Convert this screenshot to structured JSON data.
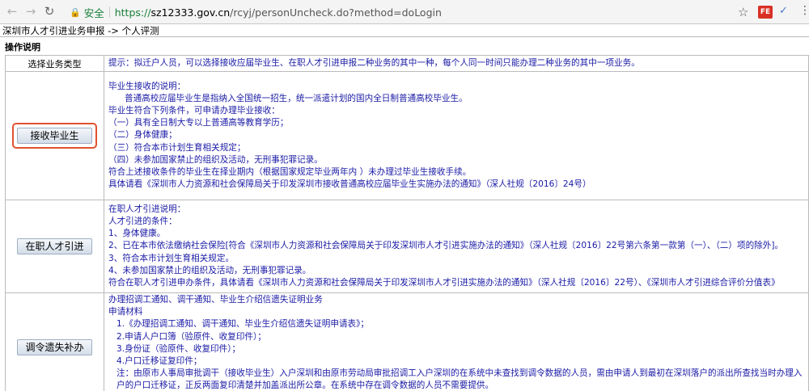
{
  "browser": {
    "secure_label": "安全",
    "url_proto": "https://",
    "url_host": "sz12333.gov.cn",
    "url_path": "/rcyj/personUncheck.do?method=doLogin",
    "ext_label": "FE"
  },
  "breadcrumb": "深圳市人才引进业务申报 -> 个人评测",
  "ops_title": "操作说明",
  "header_row": {
    "label": "选择业务类型",
    "hint": "提示：拟迁户人员，可以选择接收应届毕业生、在职人才引进申报二种业务的其中一种，每个人同一时间只能办理二种业务的其中一项业务。"
  },
  "rows": [
    {
      "button": "接收毕业生",
      "lines": [
        "毕业生接收的说明：",
        "普通高校应届毕业生是指纳入全国统一招生，统一派遣计划的国内全日制普通高校毕业生。",
        "毕业生符合下列条件，可申请办理毕业接收：",
        "（一）具有全日制大专以上普通高等教育学历；",
        "（二）身体健康；",
        "（三）符合本市计划生育相关规定；",
        "（四）未参加国家禁止的组织及活动，无刑事犯罪记录。",
        "符合上述接收条件的毕业生在择业期内（根据国家规定毕业两年内 ）未办理过毕业生接收手续。",
        "具体请看《深圳市人力资源和社会保障局关于印发深圳市接收普通高校应届毕业生实施办法的通知》（深人社规〔2016〕24号）"
      ]
    },
    {
      "button": "在职人才引进",
      "lines": [
        "在职人才引进说明：",
        "人才引进的条件：",
        "1、身体健康。",
        "2、已在本市依法缴纳社会保险[符合《深圳市人力资源和社会保障局关于印发深圳市人才引进实施办法的通知》（深人社规〔2016〕22号第六条第一款第（一）、（二）项的除外]。",
        "3、符合本市计划生育相关规定。",
        "4、未参加国家禁止的组织及活动，无刑事犯罪记录。",
        "符合在职人才引进申办条件，具体请看《深圳市人力资源和社会保障局关于印发深圳市人才引进实施办法的通知》（深人社规〔2016〕22号）、《深圳市人才引进综合评价分值表》"
      ]
    },
    {
      "button": "调令遗失补办",
      "lines": [
        "办理招调工通知、调干通知、毕业生介绍信遗失证明业务",
        "申请材料",
        "1.《办理招调工通知、调干通知、毕业生介绍信遗失证明申请表》；",
        "2.申请人户口簿（验原件、收复印件）；",
        "3.身份证（验原件、收复印件）；",
        "4.户口迁移证复印件；",
        "注：由原市人事局审批调干（接收毕业生）入户深圳和由原市劳动局审批招调工入户深圳的在系统中未查找到调令数据的人员，需由申请人到最初在深圳落户的派出所查找当时办理入户的户口迁移证，正反两面复印清楚并加盖派出所公章。在系统中存在调令数据的人员不需要提供。"
      ]
    }
  ]
}
